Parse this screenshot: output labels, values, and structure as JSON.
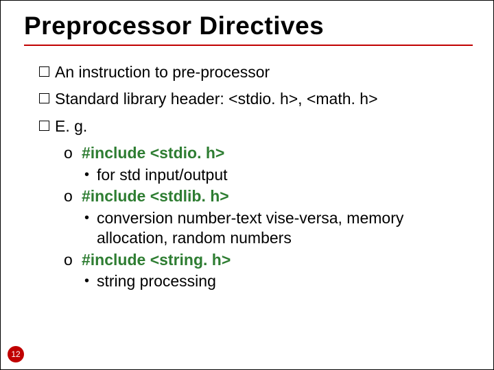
{
  "title": "Preprocessor Directives",
  "bullets": {
    "b1": "An instruction to pre-processor",
    "b2": "Standard library header: <stdio. h>, <math. h>",
    "b3": "E. g."
  },
  "items": {
    "i1": {
      "include": "#include <stdio. h>",
      "desc": "for std input/output"
    },
    "i2": {
      "include": "#include <stdlib. h>",
      "desc": "conversion number-text vise-versa, memory allocation, random numbers"
    },
    "i3": {
      "include": "#include <string. h>",
      "desc": "string processing"
    }
  },
  "markers": {
    "circle": "o",
    "dot": "•"
  },
  "page": "12"
}
